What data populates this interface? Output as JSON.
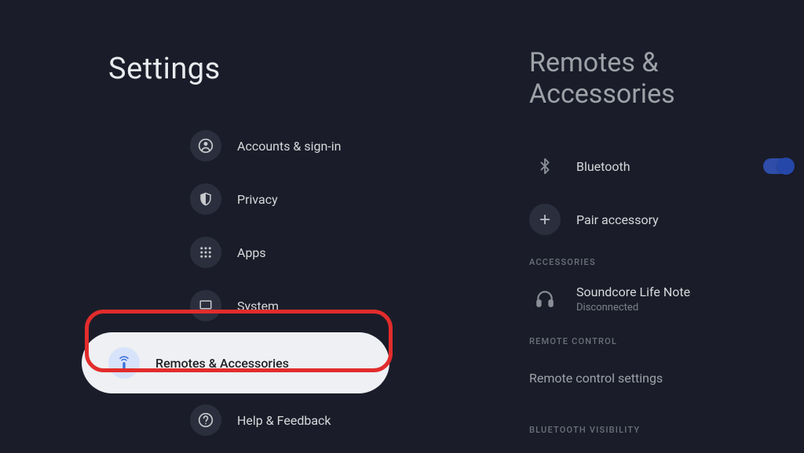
{
  "left": {
    "title": "Settings",
    "items": [
      {
        "id": "accounts",
        "label": "Accounts & sign-in"
      },
      {
        "id": "privacy",
        "label": "Privacy"
      },
      {
        "id": "apps",
        "label": "Apps"
      },
      {
        "id": "system",
        "label": "System"
      },
      {
        "id": "remotes",
        "label": "Remotes & Accessories",
        "selected": true
      },
      {
        "id": "help",
        "label": "Help & Feedback"
      }
    ]
  },
  "right": {
    "title": "Remotes & Accessories",
    "bluetooth": {
      "label": "Bluetooth",
      "on": true
    },
    "pair": {
      "label": "Pair accessory"
    },
    "sections": {
      "accessories": {
        "header": "ACCESSORIES",
        "items": [
          {
            "label": "Soundcore Life Note",
            "sublabel": "Disconnected"
          }
        ]
      },
      "remote_control": {
        "header": "REMOTE CONTROL",
        "items": [
          {
            "label": "Remote control settings"
          }
        ]
      },
      "bluetooth_visibility": {
        "header": "BLUETOOTH VISIBILITY"
      }
    }
  }
}
